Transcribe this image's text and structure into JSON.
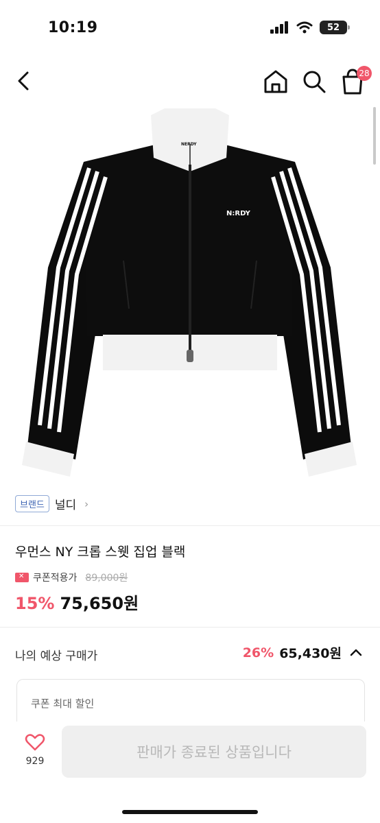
{
  "status_bar": {
    "time": "10:19",
    "battery": "52"
  },
  "nav": {
    "cart_count": "28"
  },
  "product_image": {
    "chest_logo": "N:RDY",
    "neck_label": "NERDY"
  },
  "brand": {
    "tag": "브랜드",
    "name": "널디",
    "chevron": "›"
  },
  "product": {
    "title": "우먼스 NY 크롭 스웻 집업 블랙",
    "coupon_label": "쿠폰적용가",
    "original_price": "89,000원",
    "discount": "15%",
    "price": "75,650원"
  },
  "expected": {
    "label": "나의 예상 구매가",
    "discount": "26%",
    "price": "65,430원"
  },
  "coupon_box": {
    "label": "쿠폰 최대 할인"
  },
  "bottom": {
    "like_count": "929",
    "sold_out_label": "판매가 종료된 상품입니다"
  },
  "colors": {
    "accent": "#f0566a",
    "brand_tag": "#3d64b3"
  }
}
